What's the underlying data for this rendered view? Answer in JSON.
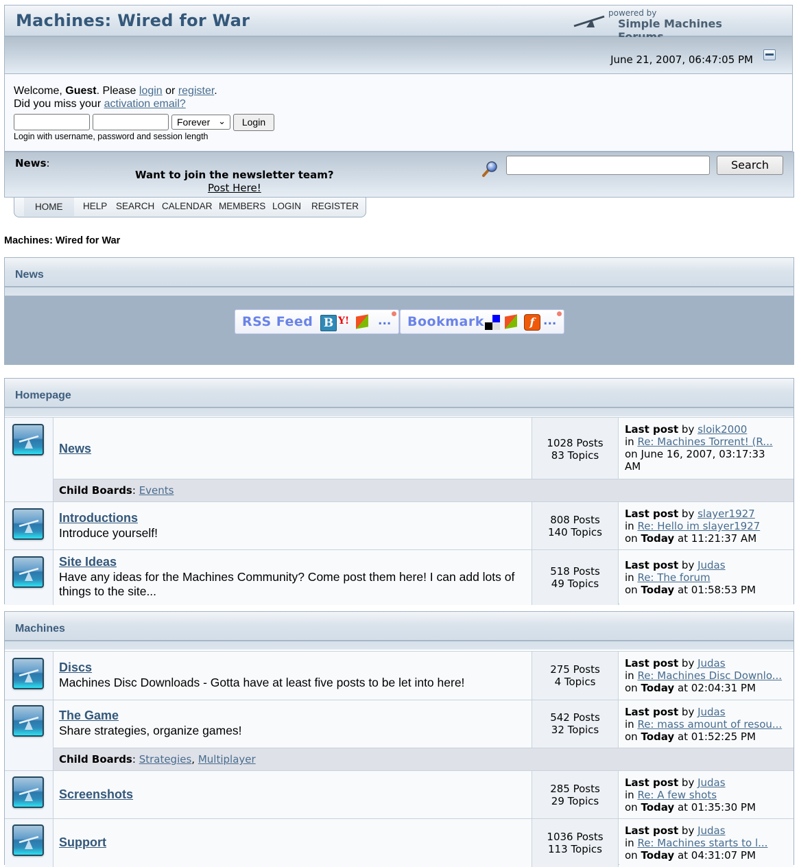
{
  "header": {
    "title": "Machines: Wired for War",
    "powered_by": "powered by",
    "powered_name": "Simple Machines Forums",
    "datetime": "June 21, 2007, 06:47:05 PM"
  },
  "login": {
    "welcome_prefix": "Welcome, ",
    "guest": "Guest",
    "please": ". Please ",
    "login_link": "login",
    "or": " or ",
    "register_link": "register",
    "period": ".",
    "missed": "Did you miss your ",
    "activation_link": "activation email?",
    "username_value": "",
    "password_value": "",
    "session_length": "Forever",
    "login_button": "Login",
    "hint": "Login with username, password and session length"
  },
  "newsbar": {
    "label": "News",
    "colon": ":",
    "headline": "Want to join the newsletter team?",
    "post_link": "Post Here!",
    "search_value": "",
    "search_button": "Search"
  },
  "nav": {
    "tabs": [
      "HOME",
      "HELP",
      "SEARCH",
      "CALENDAR",
      "MEMBERS",
      "LOGIN",
      "REGISTER"
    ],
    "active": "HOME"
  },
  "breadcrumb": "Machines: Wired for War",
  "news_section": {
    "title": "News",
    "rss_label": "RSS Feed",
    "bookmark_label": "Bookmark",
    "more": "..."
  },
  "categories": [
    {
      "title": "Homepage",
      "boards": [
        {
          "name": "News",
          "description": "",
          "posts": "1028 Posts",
          "topics": "83 Topics",
          "last_post_label": "Last post",
          "by": " by ",
          "author": "sloik2000",
          "in": "in ",
          "topic": "Re: Machines Torrent! (R...",
          "on_prefix": "on June 16, 2007, 03:17:33",
          "on_suffix": "AM",
          "child_label": "Child Boards",
          "children": [
            "Events"
          ]
        },
        {
          "name": "Introductions",
          "description": "Introduce yourself!",
          "posts": "808 Posts",
          "topics": "140 Topics",
          "last_post_label": "Last post",
          "by": " by ",
          "author": "slayer1927",
          "in": "in ",
          "topic": "Re: Hello im slayer1927",
          "on": "on ",
          "today": "Today",
          "time": " at 11:21:37 AM"
        },
        {
          "name": "Site Ideas",
          "description": "Have any ideas for the Machines Community? Come post them here! I can add lots of things to the site...",
          "posts": "518 Posts",
          "topics": "49 Topics",
          "last_post_label": "Last post",
          "by": " by ",
          "author": "Judas",
          "in": "in ",
          "topic": "Re: The forum",
          "on": "on ",
          "today": "Today",
          "time": " at 01:58:53 PM"
        }
      ]
    },
    {
      "title": "Machines",
      "boards": [
        {
          "name": "Discs",
          "description": "Machines Disc Downloads - Gotta have at least five posts to be let into here!",
          "posts": "275 Posts",
          "topics": "4 Topics",
          "last_post_label": "Last post",
          "by": " by ",
          "author": "Judas",
          "in": "in ",
          "topic": "Re: Machines Disc Downlo...",
          "on": "on ",
          "today": "Today",
          "time": " at 02:04:31 PM"
        },
        {
          "name": "The Game",
          "description": "Share strategies, organize games!",
          "posts": "542 Posts",
          "topics": "32 Topics",
          "last_post_label": "Last post",
          "by": " by ",
          "author": "Judas",
          "in": "in ",
          "topic": "Re: mass amount of resou...",
          "on": "on ",
          "today": "Today",
          "time": " at 01:52:25 PM",
          "child_label": "Child Boards",
          "children": [
            "Strategies",
            "Multiplayer"
          ]
        },
        {
          "name": "Screenshots",
          "description": "",
          "posts": "285 Posts",
          "topics": "29 Topics",
          "last_post_label": "Last post",
          "by": " by ",
          "author": "Judas",
          "in": "in ",
          "topic": "Re: A few shots",
          "on": "on ",
          "today": "Today",
          "time": " at 01:35:30 PM"
        },
        {
          "name": "Support",
          "description": "",
          "posts": "1036 Posts",
          "topics": "113 Topics",
          "last_post_label": "Last post",
          "by": " by ",
          "author": "Judas",
          "in": "in ",
          "topic": "Re: Machines starts to l...",
          "on": "on ",
          "today": "Today",
          "time": " at 04:31:07 PM"
        }
      ]
    }
  ]
}
